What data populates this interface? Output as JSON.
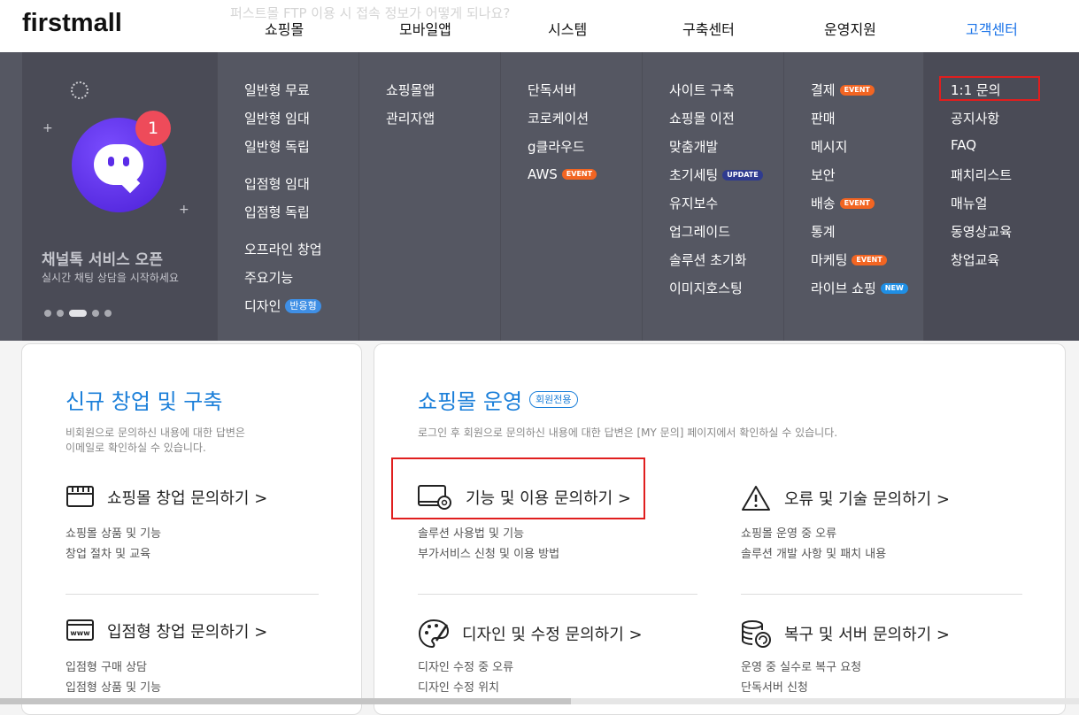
{
  "header": {
    "logo": "firstmall",
    "notice": "퍼스트몰 FTP 이용 시 접속 정보가 어떻게 되나요?",
    "nav": [
      "쇼핑몰",
      "모바일앱",
      "시스템",
      "구축센터",
      "운영지원",
      "고객센터"
    ],
    "active_nav": "고객센터",
    "accent_color": "#1a73e8"
  },
  "promo": {
    "badge_count": "1",
    "title": "채널톡 서비스 오픈",
    "subtitle": "실시간 채팅 상담을 시작하세요",
    "carousel_dots": 5,
    "active_dot": 3
  },
  "mega_menu": {
    "shop": [
      "일반형 무료",
      "일반형 임대",
      "일반형 독립",
      "입점형 임대",
      "입점형 독립",
      "오프라인 창업",
      "주요기능",
      "디자인"
    ],
    "shop_design_tag": "반응형",
    "mobile": [
      "쇼핑몰앱",
      "관리자앱"
    ],
    "system": [
      "단독서버",
      "코로케이션",
      "g클라우드",
      "AWS"
    ],
    "build": [
      "사이트 구축",
      "쇼핑몰 이전",
      "맞춤개발",
      "초기세팅",
      "유지보수",
      "업그레이드",
      "솔루션 초기화",
      "이미지호스팅"
    ],
    "ops": [
      "결제",
      "판매",
      "메시지",
      "보안",
      "배송",
      "통계",
      "마케팅",
      "라이브 쇼핑"
    ],
    "cs": [
      "1:1 문의",
      "공지사항",
      "FAQ",
      "패치리스트",
      "매뉴얼",
      "동영상교육",
      "창업교육"
    ],
    "tag_event": "EVENT",
    "tag_update": "UPDATE",
    "tag_new": "NEW"
  },
  "left_card": {
    "title": "신규 창업 및 구축",
    "desc_line1": "비회원으로 문의하신 내용에 대한 답변은",
    "desc_line2": "이메일로 확인하실 수 있습니다.",
    "items": [
      {
        "label": "쇼핑몰 창업 문의하기 >",
        "subs": [
          "쇼핑몰 상품 및 기능",
          "창업 절차 및 교육"
        ]
      },
      {
        "label": "입점형 창업 문의하기 >",
        "subs": [
          "입점형 구매 상담",
          "입점형 상품 및 기능"
        ]
      }
    ]
  },
  "right_card": {
    "title": "쇼핑몰 운영",
    "badge": "회원전용",
    "desc": "로그인 후 회원으로 문의하신 내용에 대한 답변은 [MY 문의] 페이지에서 확인하실 수 있습니다.",
    "items": [
      {
        "label": "기능 및 이용 문의하기 >",
        "subs": [
          "솔루션 사용법 및 기능",
          "부가서비스 신청 및 이용 방법"
        ]
      },
      {
        "label": "오류 및 기술 문의하기 >",
        "subs": [
          "쇼핑몰 운영 중 오류",
          "솔루션 개발 사항 및 패치 내용"
        ]
      },
      {
        "label": "디자인 및 수정 문의하기 >",
        "subs": [
          "디자인 수정 중 오류",
          "디자인 수정 위치"
        ]
      },
      {
        "label": "복구 및 서버 문의하기 >",
        "subs": [
          "운영 중 실수로 복구 요청",
          "단독서버 신청"
        ]
      }
    ]
  },
  "highlight_color": "#e01e1e"
}
